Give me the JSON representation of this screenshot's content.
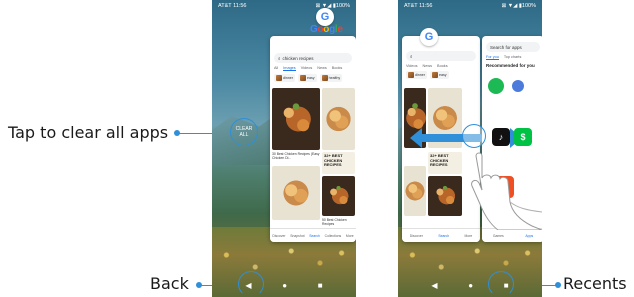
{
  "callouts": {
    "clear_all": "Tap to clear all apps",
    "back": "Back",
    "recents": "Recents"
  },
  "status_bar": {
    "carrier_time": "AT&T 11:56",
    "indicators": "⊠ ▼◢ ▮100%"
  },
  "nav_bar": {
    "back": "◀",
    "home": "●",
    "recents": "■"
  },
  "left_screen": {
    "clear_all_label": "CLEAR ALL",
    "search_query": "chicken recipes",
    "search_tabs": [
      "All",
      "Images",
      "Videos",
      "News",
      "Books"
    ],
    "active_tab": "Images",
    "chips": [
      "dinner",
      "easy",
      "healthy"
    ],
    "captions": [
      "30 Best Chicken Recipes (Easy Chicken Di...",
      "32+ BEST CHICKEN RECIPES",
      "BEST CHICKEN RECIPES",
      "50 Best Chicken Recipes"
    ],
    "promo_text": "32+ BEST CHICKEN RECIPES",
    "bottom_nav": [
      "Discover",
      "Snapshot",
      "Search",
      "Collections",
      "More"
    ],
    "active_nav": "Search"
  },
  "right_screen": {
    "search_placeholder": "Search for apps",
    "play_tabs": [
      "For you",
      "Top charts"
    ],
    "recommended_title": "Recommended for you",
    "apps": [
      {
        "name": "Spotify",
        "color": "#1db954"
      },
      {
        "name": "TikTok",
        "color": "#111111"
      },
      {
        "name": "Cash App",
        "color": "#00c244"
      },
      {
        "name": "Tubi",
        "color": "#f04e23"
      }
    ],
    "bottom_nav": [
      "Games",
      "Apps"
    ]
  },
  "colors": {
    "accent": "#2f8fd8"
  }
}
